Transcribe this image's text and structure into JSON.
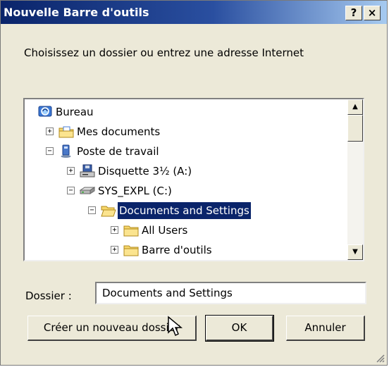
{
  "window": {
    "title": "Nouvelle Barre d'outils",
    "help_label": "?",
    "close_label": "×"
  },
  "prompt": "Choisissez un dossier ou entrez une adresse Internet",
  "tree": {
    "items": [
      {
        "label": "Bureau",
        "icon": "desktop-icon",
        "expander": ""
      },
      {
        "label": "Mes documents",
        "icon": "my-documents-folder-icon",
        "expander": "+"
      },
      {
        "label": "Poste de travail",
        "icon": "computer-icon",
        "expander": "−"
      },
      {
        "label": "Disquette 3½ (A:)",
        "icon": "floppy-drive-icon",
        "expander": "+"
      },
      {
        "label": "SYS_EXPL (C:)",
        "icon": "hard-drive-icon",
        "expander": "−"
      },
      {
        "label": "Documents and Settings",
        "icon": "open-folder-icon",
        "expander": "−",
        "selected": true
      },
      {
        "label": "All Users",
        "icon": "folder-icon",
        "expander": "+"
      },
      {
        "label": "Barre d'outils",
        "icon": "folder-icon",
        "expander": "+"
      }
    ]
  },
  "folder": {
    "label": "Dossier :",
    "value": "Documents and Settings"
  },
  "buttons": {
    "new_folder": "Créer un nouveau dossier",
    "ok": "OK",
    "cancel": "Annuler"
  },
  "colors": {
    "title_gradient_start": "#0a246a",
    "title_gradient_end": "#a6caf0",
    "dialog_bg": "#ece9d8",
    "selection": "#0a246a"
  }
}
